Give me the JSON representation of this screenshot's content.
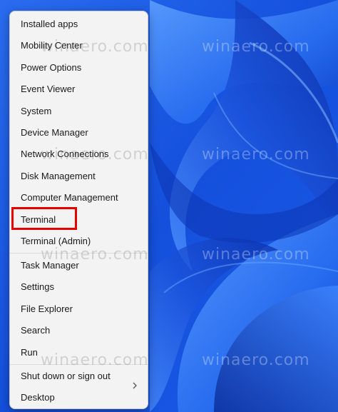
{
  "menu": {
    "items": [
      {
        "label": "Installed apps"
      },
      {
        "label": "Mobility Center"
      },
      {
        "label": "Power Options"
      },
      {
        "label": "Event Viewer"
      },
      {
        "label": "System"
      },
      {
        "label": "Device Manager"
      },
      {
        "label": "Network Connections"
      },
      {
        "label": "Disk Management"
      },
      {
        "label": "Computer Management"
      },
      {
        "label": "Terminal"
      },
      {
        "label": "Terminal (Admin)"
      },
      {
        "label": "Task Manager"
      },
      {
        "label": "Settings"
      },
      {
        "label": "File Explorer"
      },
      {
        "label": "Search"
      },
      {
        "label": "Run"
      },
      {
        "label": "Shut down or sign out"
      },
      {
        "label": "Desktop"
      }
    ],
    "submenu_icon": "chevron-right-icon",
    "highlighted_item": "Terminal"
  },
  "watermark": {
    "text": "winaero.com"
  },
  "colors": {
    "highlight": "#e60000",
    "wallpaper": "#1d5fe6",
    "menu_background": "#f3f3f3"
  }
}
